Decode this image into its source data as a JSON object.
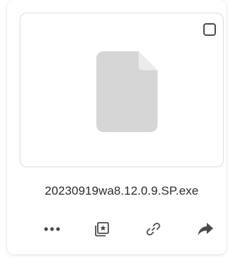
{
  "file": {
    "name": "20230919wa8.12.0.9.SP.exe",
    "icon": "file-icon"
  },
  "selection": {
    "checked": false
  },
  "actions": [
    {
      "icon": "more-horizontal-icon"
    },
    {
      "icon": "favorite-star-icon"
    },
    {
      "icon": "link-icon"
    },
    {
      "icon": "share-arrow-icon"
    }
  ],
  "colors": {
    "icon": "#4a4a4a",
    "file_placeholder": "#d6d6d6",
    "text": "#2b2b2b"
  }
}
